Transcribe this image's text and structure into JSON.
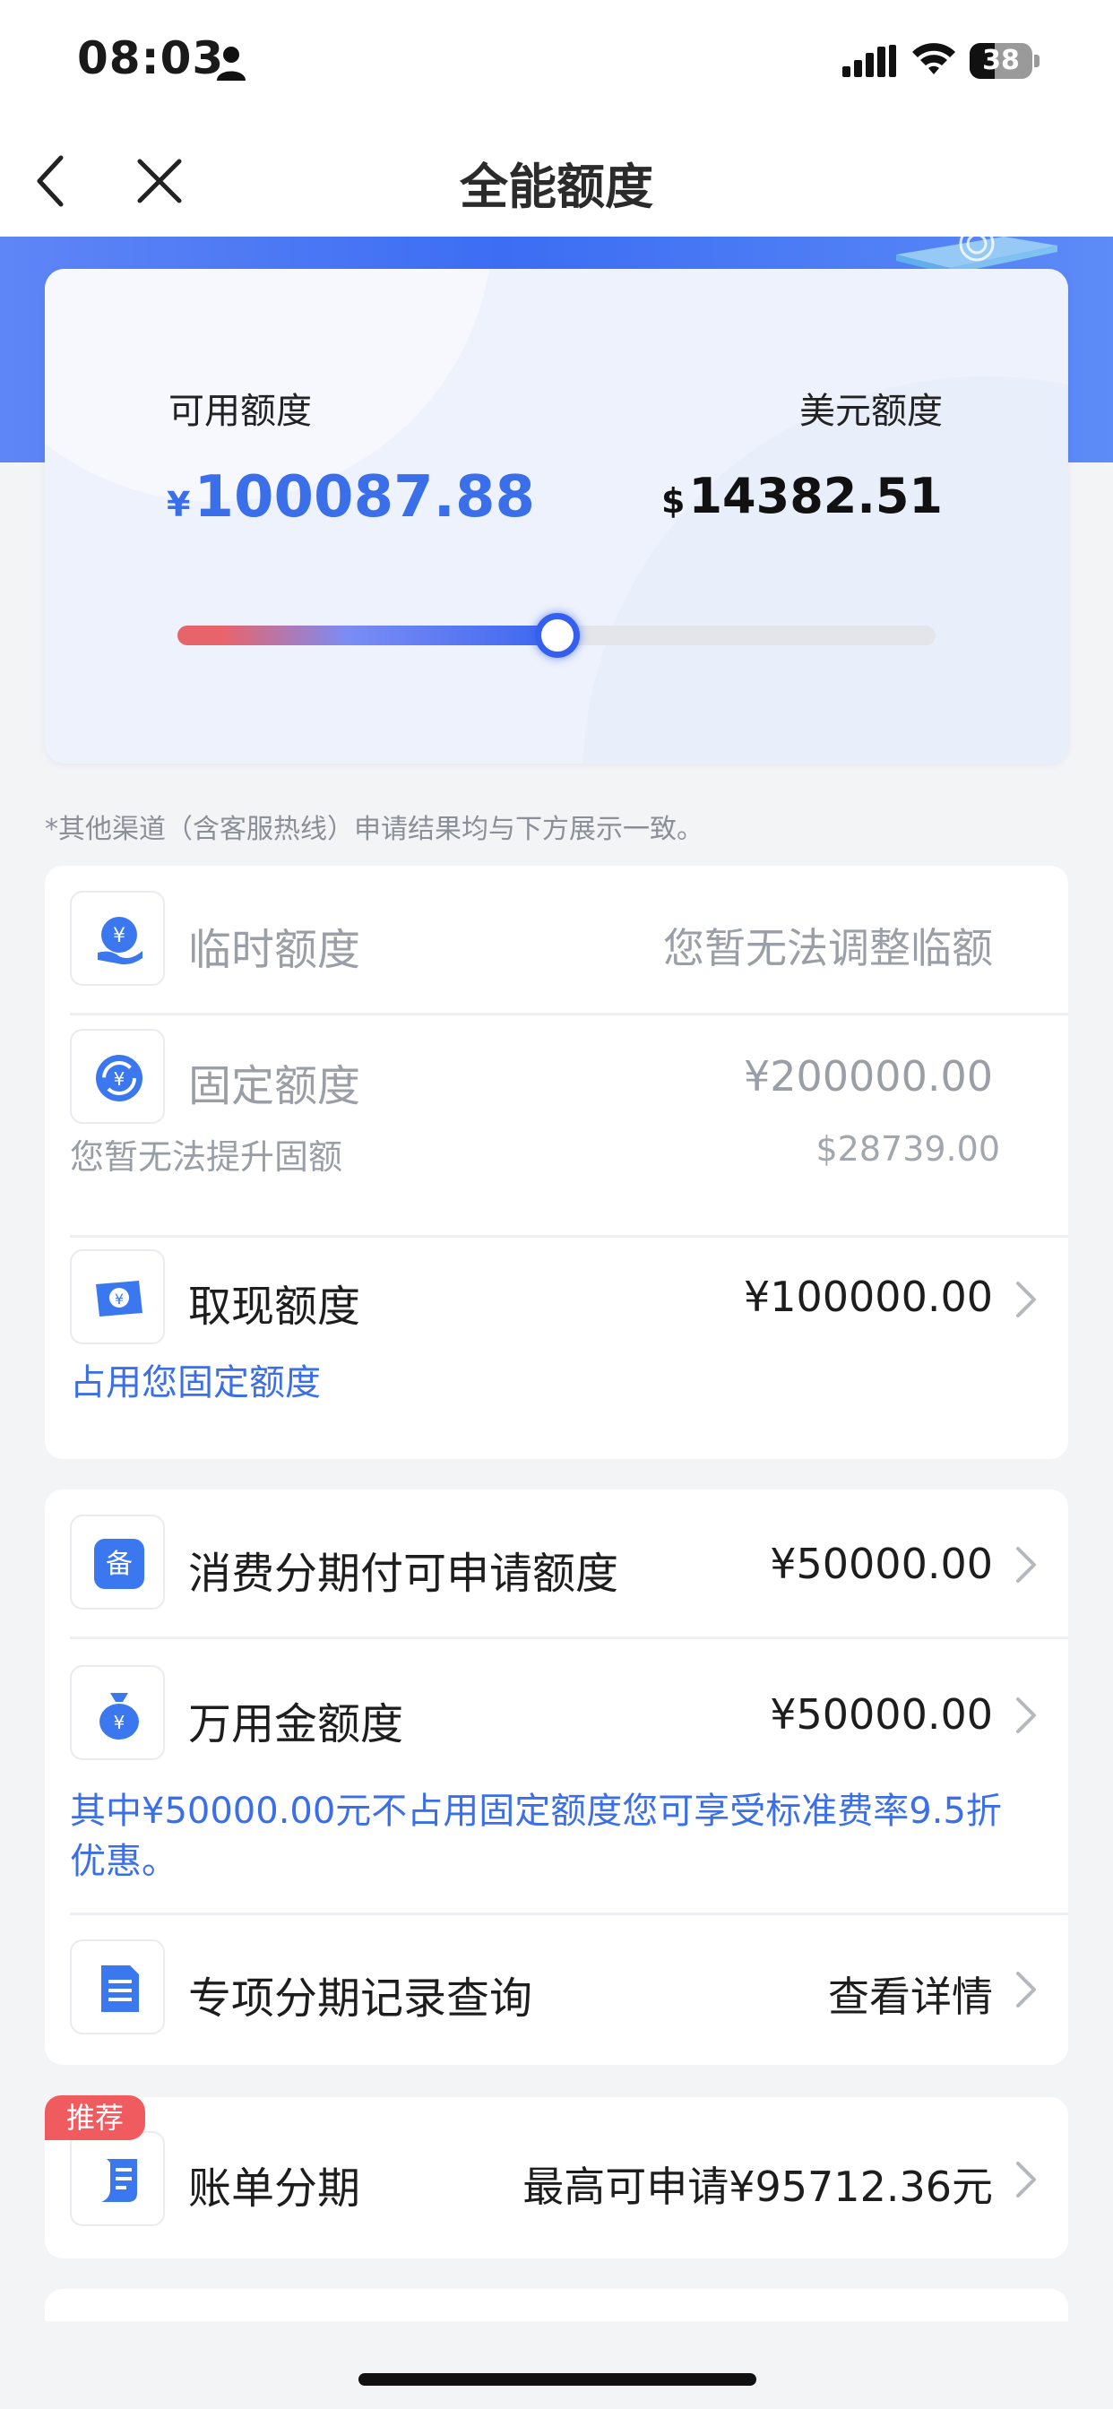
{
  "status_bar": {
    "time": "08:03",
    "battery": "38"
  },
  "nav": {
    "title": "全能额度"
  },
  "quota_card": {
    "available_label": "可用额度",
    "available_symbol": "¥",
    "available_value": "100087.88",
    "usd_label": "美元额度",
    "usd_symbol": "$",
    "usd_value": "14382.51",
    "usage_fraction": 0.5
  },
  "notice": "*其他渠道（含客服热线）申请结果均与下方展示一致。",
  "group1": {
    "temp": {
      "title": "临时额度",
      "value": "您暂无法调整临额"
    },
    "fixed": {
      "title": "固定额度",
      "value": "¥200000.00",
      "sub_left": "您暂无法提升固额",
      "sub_right": "$28739.00"
    },
    "cash": {
      "title": "取现额度",
      "value": "¥100000.00",
      "note": "占用您固定额度"
    }
  },
  "group2": {
    "installment": {
      "title": "消费分期付可申请额度",
      "value": "¥50000.00"
    },
    "wanyong": {
      "title": "万用金额度",
      "value": "¥50000.00",
      "note_line1": "其中¥50000.00元不占用固定额度您可享受标准费率9.5折",
      "note_line2": "优惠。"
    },
    "special": {
      "title": "专项分期记录查询",
      "value": "查看详情"
    }
  },
  "group3": {
    "badge": "推荐",
    "bill": {
      "title": "账单分期",
      "value": "最高可申请¥95712.36元"
    }
  },
  "colors": {
    "accent": "#3b6fe9",
    "badge": "#ef5b5f"
  }
}
